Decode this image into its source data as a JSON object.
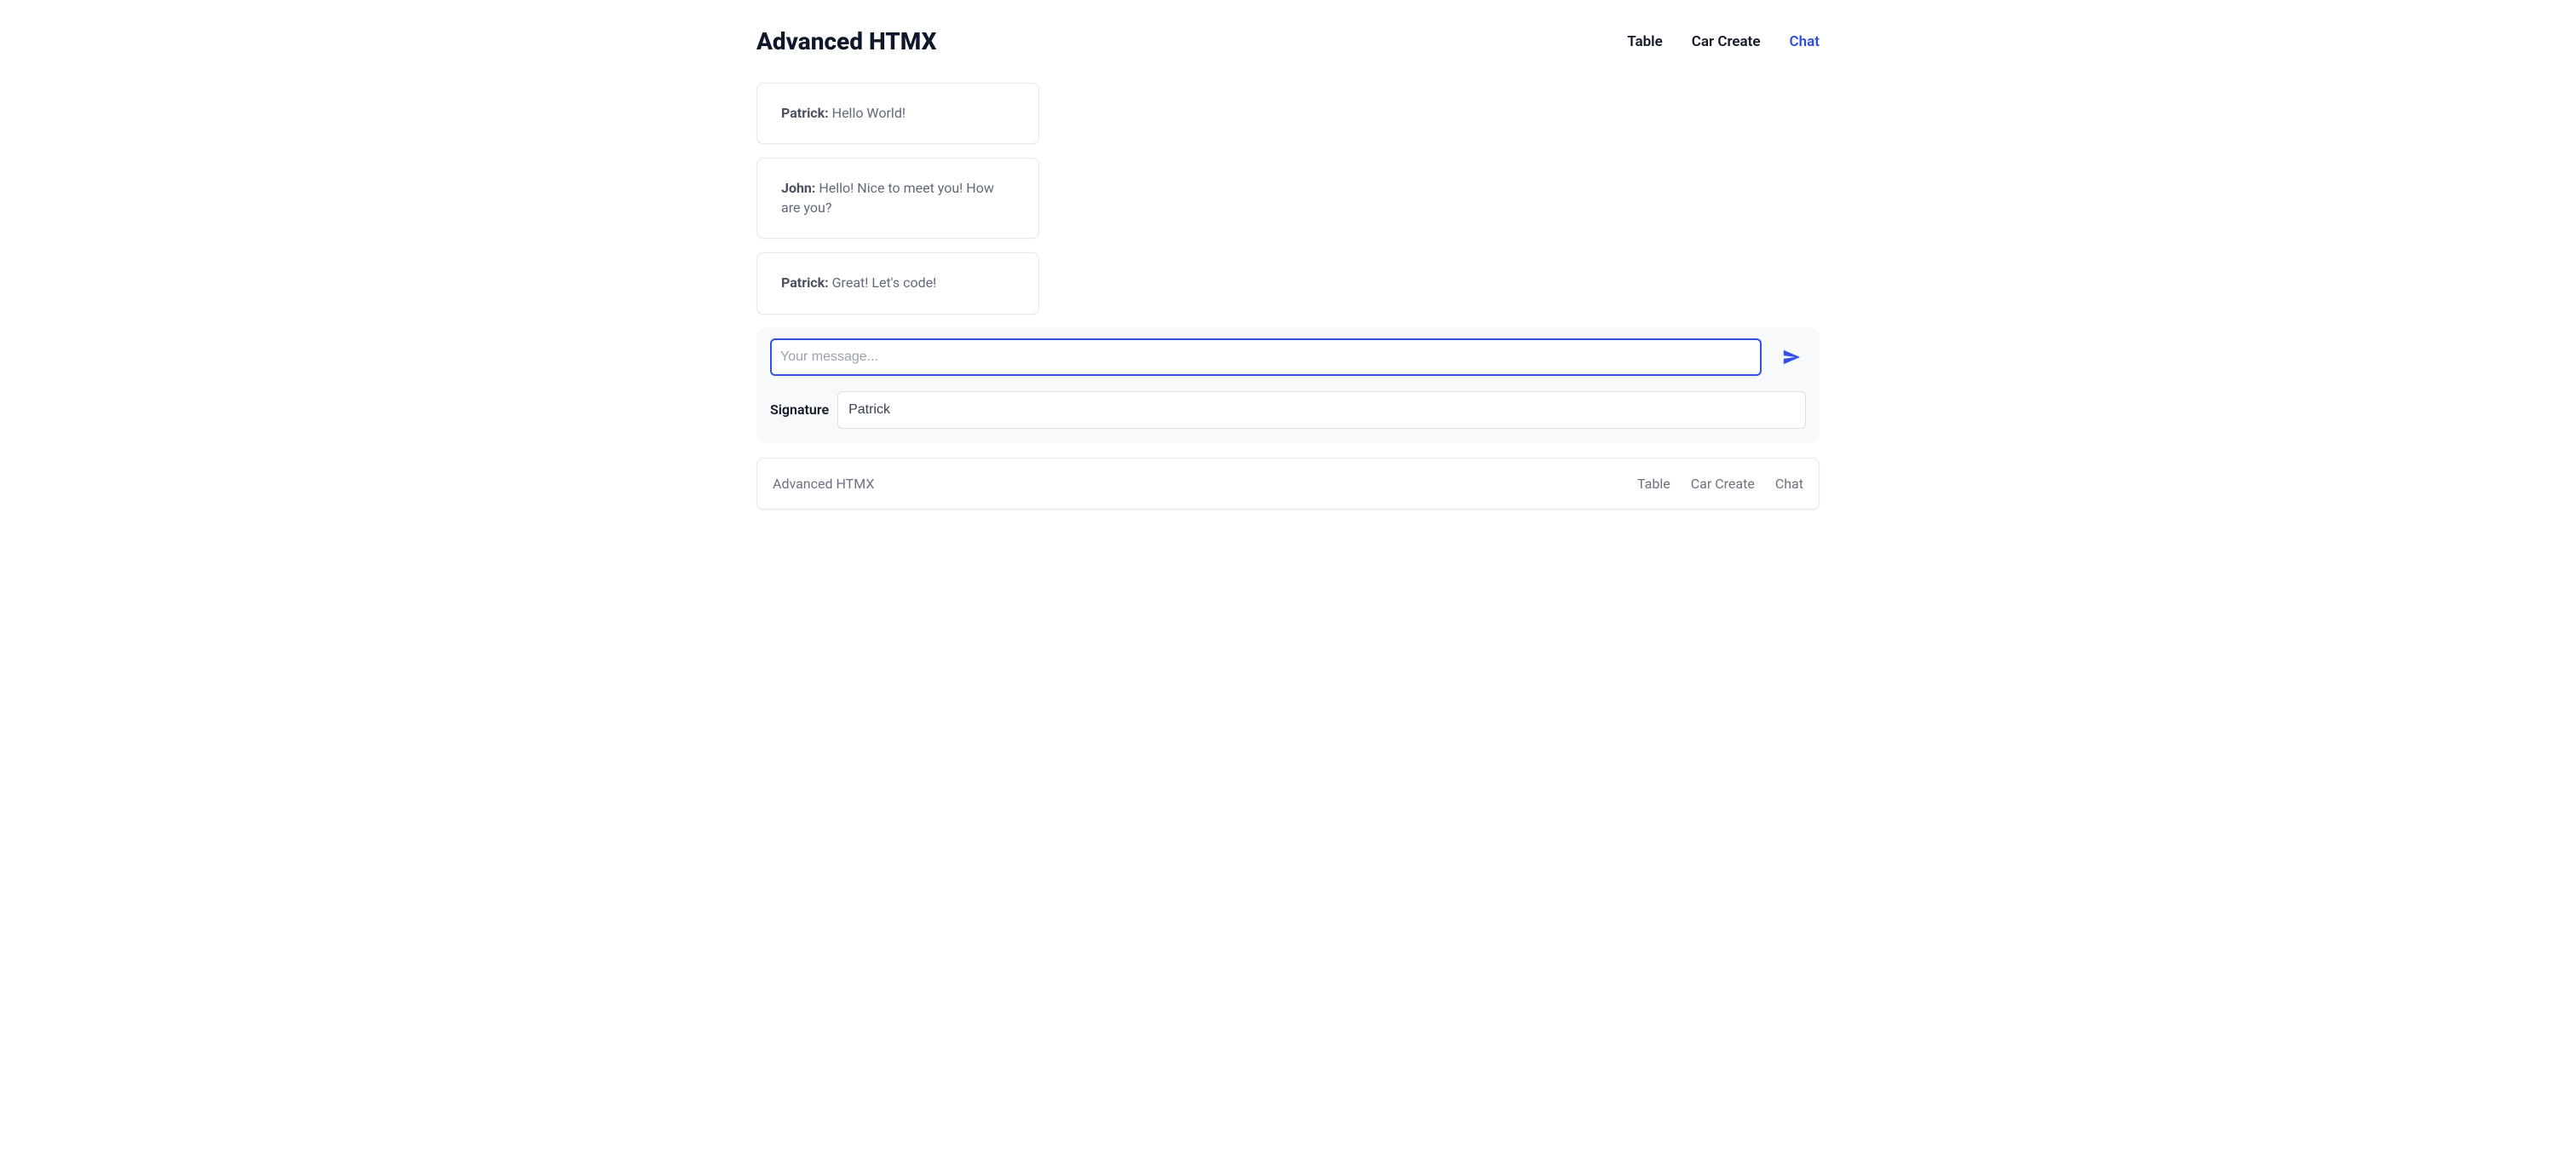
{
  "header": {
    "title": "Advanced HTMX",
    "nav": [
      {
        "label": "Table",
        "active": false
      },
      {
        "label": "Car Create",
        "active": false
      },
      {
        "label": "Chat",
        "active": true
      }
    ]
  },
  "chat": {
    "messages": [
      {
        "author": "Patrick:",
        "text": " Hello World!"
      },
      {
        "author": "John:",
        "text": " Hello! Nice to meet you! How are you?"
      },
      {
        "author": "Patrick:",
        "text": " Great! Let's code!"
      }
    ],
    "input": {
      "placeholder": "Your message...",
      "value": ""
    },
    "signature": {
      "label": "Signature",
      "value": "Patrick"
    },
    "icons": {
      "send": "send-icon"
    }
  },
  "footer": {
    "brand": "Advanced HTMX",
    "nav": [
      {
        "label": "Table"
      },
      {
        "label": "Car Create"
      },
      {
        "label": "Chat"
      }
    ]
  }
}
